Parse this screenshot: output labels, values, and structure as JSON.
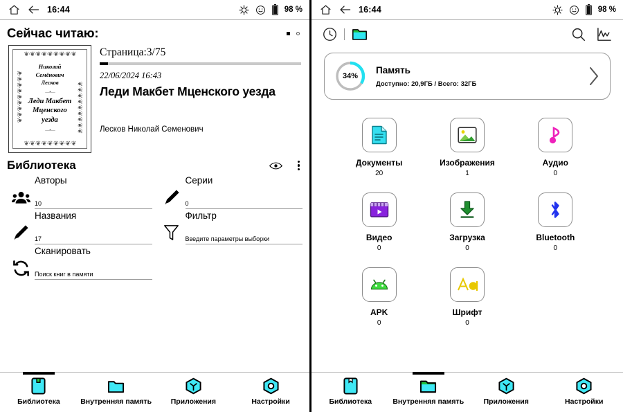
{
  "statusbar": {
    "time": "16:44",
    "battery_text": "98 %",
    "home_icon": "home-icon",
    "back_icon": "back-arrow-icon",
    "brightness_icon": "brightness-icon",
    "face_icon": "smiley-face-icon",
    "battery_icon": "battery-full-icon"
  },
  "left": {
    "now_reading": {
      "heading": "Сейчас читаю:",
      "page_label": "Страница:3/75",
      "progress_percent": 4,
      "date": "22/06/2024 16:43",
      "title": "Леди Макбет Мценского уезда",
      "author": "Лесков Николай Семенович",
      "cover": {
        "author_lines": "Николай\nСемёнович\nЛесков",
        "title_lines": "Леди Макбет\nМценского\nуезда",
        "ornament": "❦·❦·❦·❦·❦·❦·❦·❦·❦"
      },
      "page_dots": 2,
      "active_dot": 0
    },
    "library": {
      "title": "Библиотека",
      "eye_icon": "eye-icon",
      "menu_icon": "overflow-menu-icon",
      "cells": [
        {
          "label": "Авторы",
          "value": "10",
          "placeholder": "",
          "icon": "authors-group-icon"
        },
        {
          "label": "Серии",
          "value": "0",
          "placeholder": "",
          "icon": "series-pen-icon"
        },
        {
          "label": "Названия",
          "value": "17",
          "placeholder": "",
          "icon": "titles-pen-icon"
        },
        {
          "label": "Фильтр",
          "value": "",
          "placeholder": "Введите параметры выборки",
          "icon": "filter-funnel-icon"
        },
        {
          "label": "Сканировать",
          "value": "",
          "placeholder": "Поиск книг в памяти",
          "icon": "scan-refresh-icon"
        }
      ]
    },
    "nav": {
      "items": [
        {
          "label": "Библиотека",
          "icon": "book-icon",
          "active": true
        },
        {
          "label": "Внутренняя память",
          "icon": "folder-icon",
          "active": false
        },
        {
          "label": "Приложения",
          "icon": "apps-icon",
          "active": false
        },
        {
          "label": "Настройки",
          "icon": "settings-icon",
          "active": false
        }
      ]
    }
  },
  "right": {
    "toolbar": {
      "recent_icon": "clock-icon",
      "folder_icon": "folder-icon",
      "search_icon": "search-icon",
      "stats_icon": "chart-stats-icon"
    },
    "memory": {
      "percent": "34%",
      "percent_value": 34,
      "title": "Память",
      "subtitle": "Доступно: 20,9ГБ / Всего: 32ГБ",
      "chevron_icon": "chevron-right-icon",
      "ring_color": "#22e0f0"
    },
    "categories": [
      {
        "name": "Документы",
        "count": "20",
        "icon": "document-icon",
        "color": "#35dff0"
      },
      {
        "name": "Изображения",
        "count": "1",
        "icon": "image-icon",
        "color": "#3a9a3a"
      },
      {
        "name": "Аудио",
        "count": "0",
        "icon": "audio-icon",
        "color": "#ee22bb"
      },
      {
        "name": "Видео",
        "count": "0",
        "icon": "video-icon",
        "color": "#8822dd"
      },
      {
        "name": "Загрузка",
        "count": "0",
        "icon": "download-icon",
        "color": "#1f8f2f"
      },
      {
        "name": "Bluetooth",
        "count": "0",
        "icon": "bluetooth-icon",
        "color": "#2233ee"
      },
      {
        "name": "APK",
        "count": "0",
        "icon": "android-icon",
        "color": "#3ddb3d"
      },
      {
        "name": "Шрифт",
        "count": "0",
        "icon": "font-icon",
        "color": "#e8c800"
      }
    ],
    "nav": {
      "items": [
        {
          "label": "Библиотека",
          "icon": "book-icon",
          "active": false
        },
        {
          "label": "Внутренняя память",
          "icon": "folder-icon",
          "active": true
        },
        {
          "label": "Приложения",
          "icon": "apps-icon",
          "active": false
        },
        {
          "label": "Настройки",
          "icon": "settings-icon",
          "active": false
        }
      ]
    }
  }
}
